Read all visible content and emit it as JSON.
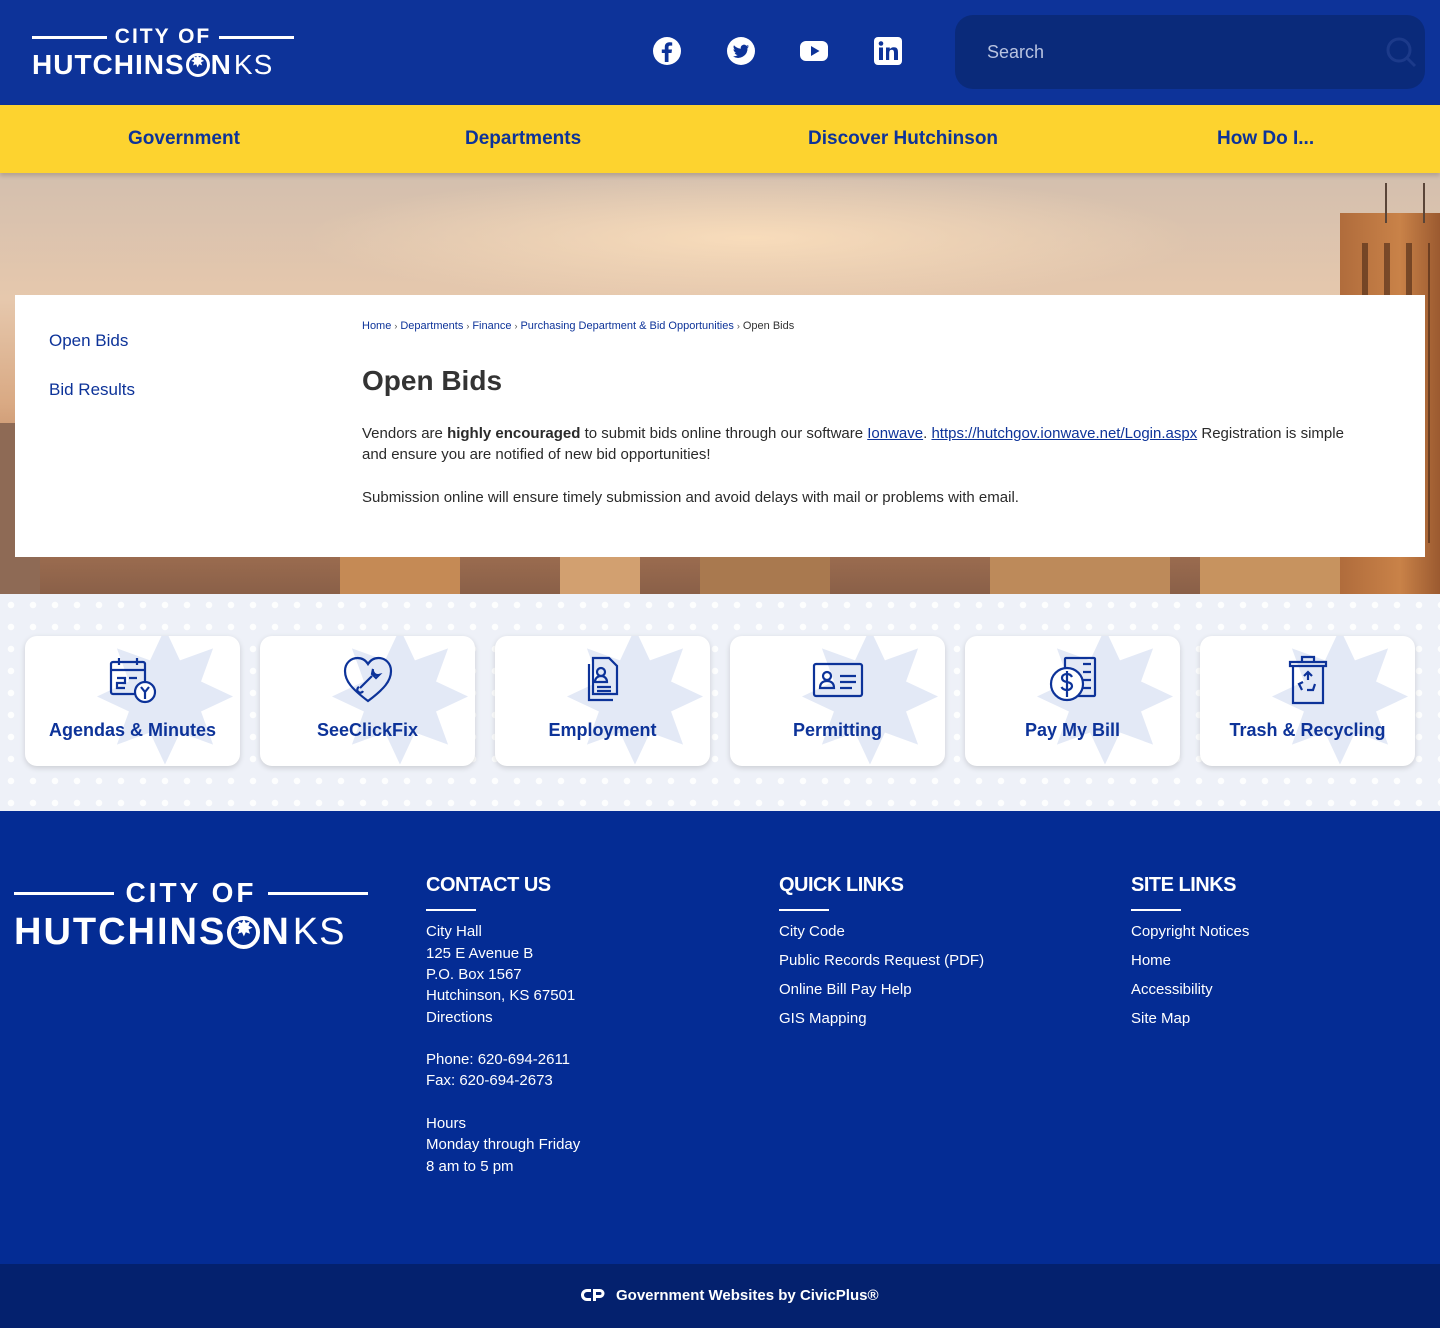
{
  "header": {
    "logo_top": "CITY OF",
    "logo_main_a": "HUTCHINS",
    "logo_main_b": "N",
    "logo_ks": "KS",
    "social": [
      {
        "name": "facebook-icon"
      },
      {
        "name": "twitter-icon"
      },
      {
        "name": "youtube-icon"
      },
      {
        "name": "linkedin-icon"
      }
    ],
    "search_placeholder": "Search"
  },
  "nav": {
    "items": [
      "Government",
      "Departments",
      "Discover Hutchinson",
      "How Do I..."
    ]
  },
  "sidebar": {
    "items": [
      "Open Bids",
      "Bid Results"
    ]
  },
  "breadcrumb": {
    "items": [
      "Home",
      "Departments",
      "Finance",
      "Purchasing Department & Bid Opportunities"
    ],
    "current": "Open Bids"
  },
  "main": {
    "title": "Open Bids",
    "p1_a": "Vendors are ",
    "p1_bold": "highly encouraged",
    "p1_b": " to submit bids online through our software ",
    "p1_link1": "Ionwave",
    "p1_c": ". ",
    "p1_link2": "https://hutchgov.ionwave.net/Login.aspx",
    "p1_d": " Registration is simple and ensure you are notified of new bid opportunities!",
    "p2": "Submission online will ensure timely submission and avoid delays with mail or problems with email."
  },
  "tiles": [
    {
      "label": "Agendas & Minutes",
      "icon": "calendar-icon"
    },
    {
      "label": "SeeClickFix",
      "icon": "heart-wrench-icon"
    },
    {
      "label": "Employment",
      "icon": "documents-icon"
    },
    {
      "label": "Permitting",
      "icon": "id-card-icon"
    },
    {
      "label": "Pay My Bill",
      "icon": "dollar-bill-icon"
    },
    {
      "label": "Trash & Recycling",
      "icon": "recycle-bin-icon"
    }
  ],
  "footer": {
    "contact": {
      "title": "CONTACT US",
      "lines": [
        "City Hall",
        "125 E Avenue B",
        "P.O. Box 1567",
        "Hutchinson, KS 67501",
        "Directions"
      ],
      "phone": "Phone: 620-694-2611",
      "fax": "Fax: 620-694-2673",
      "hours_title": "Hours",
      "hours_days": "Monday through Friday",
      "hours_time": "8 am to 5 pm"
    },
    "quick_links": {
      "title": "QUICK LINKS",
      "items": [
        "City Code",
        "Public Records Request (PDF)",
        "Online Bill Pay Help",
        "GIS Mapping"
      ]
    },
    "site_links": {
      "title": "SITE LINKS",
      "items": [
        "Copyright Notices",
        "Home",
        "Accessibility",
        "Site Map"
      ]
    },
    "civicplus": "Government Websites by CivicPlus®"
  },
  "colors": {
    "brand_blue": "#0d3399",
    "brand_yellow": "#fdd32f",
    "footer_blue": "#042c94"
  }
}
